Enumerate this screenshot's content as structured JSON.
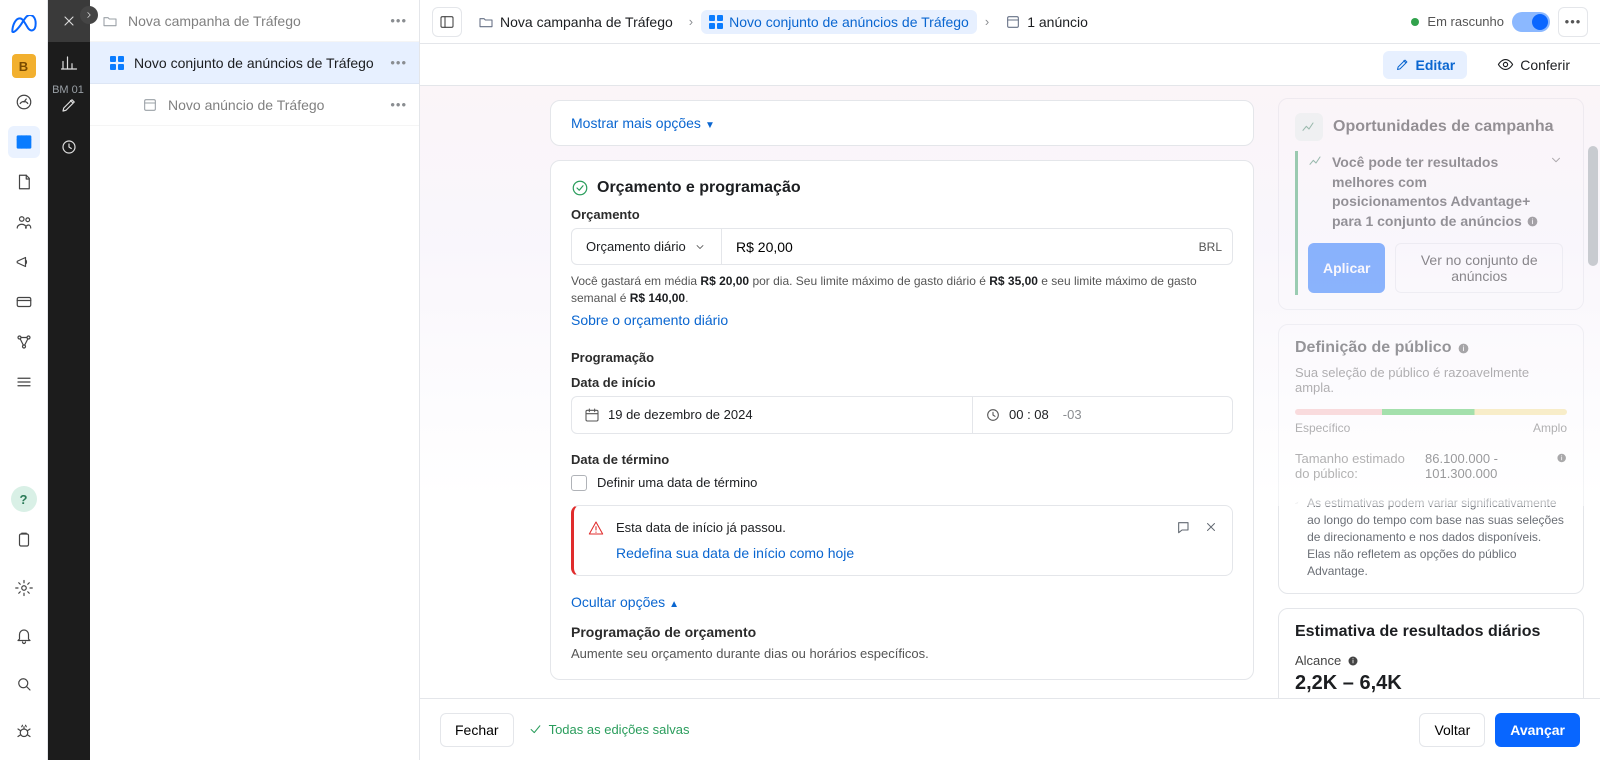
{
  "global_nav": {
    "badge": "B",
    "bm_label": "BM 01"
  },
  "tree": {
    "l1": "Nova campanha de Tráfego",
    "l2": "Novo conjunto de anúncios de Tráfego",
    "l3": "Novo anúncio de Tráfego"
  },
  "breadcrumb": {
    "campaign": "Nova campanha de Tráfego",
    "adset": "Novo conjunto de anúncios de Tráfego",
    "ad": "1 anúncio",
    "status": "Em rascunho"
  },
  "tabs": {
    "edit": "Editar",
    "review": "Conferir"
  },
  "more_options": "Mostrar mais opções",
  "budget": {
    "section_title": "Orçamento e programação",
    "label": "Orçamento",
    "type": "Orçamento diário",
    "amount": "R$ 20,00",
    "currency": "BRL",
    "hint_pre": "Você gastará em média ",
    "hint_amount": "R$ 20,00",
    "hint_mid": " por dia. Seu limite máximo de gasto diário é ",
    "hint_daily_max": "R$ 35,00",
    "hint_mid2": " e seu limite máximo de gasto semanal é ",
    "hint_weekly_max": "R$ 140,00",
    "about_link": "Sobre o orçamento diário"
  },
  "schedule": {
    "label": "Programação",
    "start_label": "Data de início",
    "start_date": "19 de dezembro de 2024",
    "start_time": "00 : 08",
    "tz": "-03",
    "end_label": "Data de término",
    "end_checkbox": "Definir uma data de término",
    "warn_title": "Esta data de início já passou.",
    "warn_action": "Redefina sua data de início como hoje",
    "hide_link": "Ocultar opções",
    "budget_sched_title": "Programação de orçamento",
    "budget_sched_sub": "Aumente seu orçamento durante dias ou horários específicos."
  },
  "opp": {
    "title": "Oportunidades de campanha",
    "item": "Você pode ter resultados melhores com posicionamentos Advantage+ para 1 conjunto de anúncios",
    "apply": "Aplicar",
    "view": "Ver no conjunto de anúncios"
  },
  "aud": {
    "title": "Definição de público",
    "sub": "Sua seleção de público é razoavelmente ampla.",
    "specific": "Específico",
    "broad": "Amplo",
    "size_k": "Tamanho estimado do público:",
    "size_v": "86.100.000 - 101.300.000",
    "note": "As estimativas podem variar significativamente ao longo do tempo com base nas suas seleções de direcionamento e nos dados disponíveis. Elas não refletem as opções do público Advantage."
  },
  "est": {
    "title": "Estimativa de resultados diários",
    "reach_label": "Alcance",
    "reach_value": "2,2K – 6,4K"
  },
  "footer": {
    "close": "Fechar",
    "saved": "Todas as edições salvas",
    "back": "Voltar",
    "next": "Avançar"
  }
}
